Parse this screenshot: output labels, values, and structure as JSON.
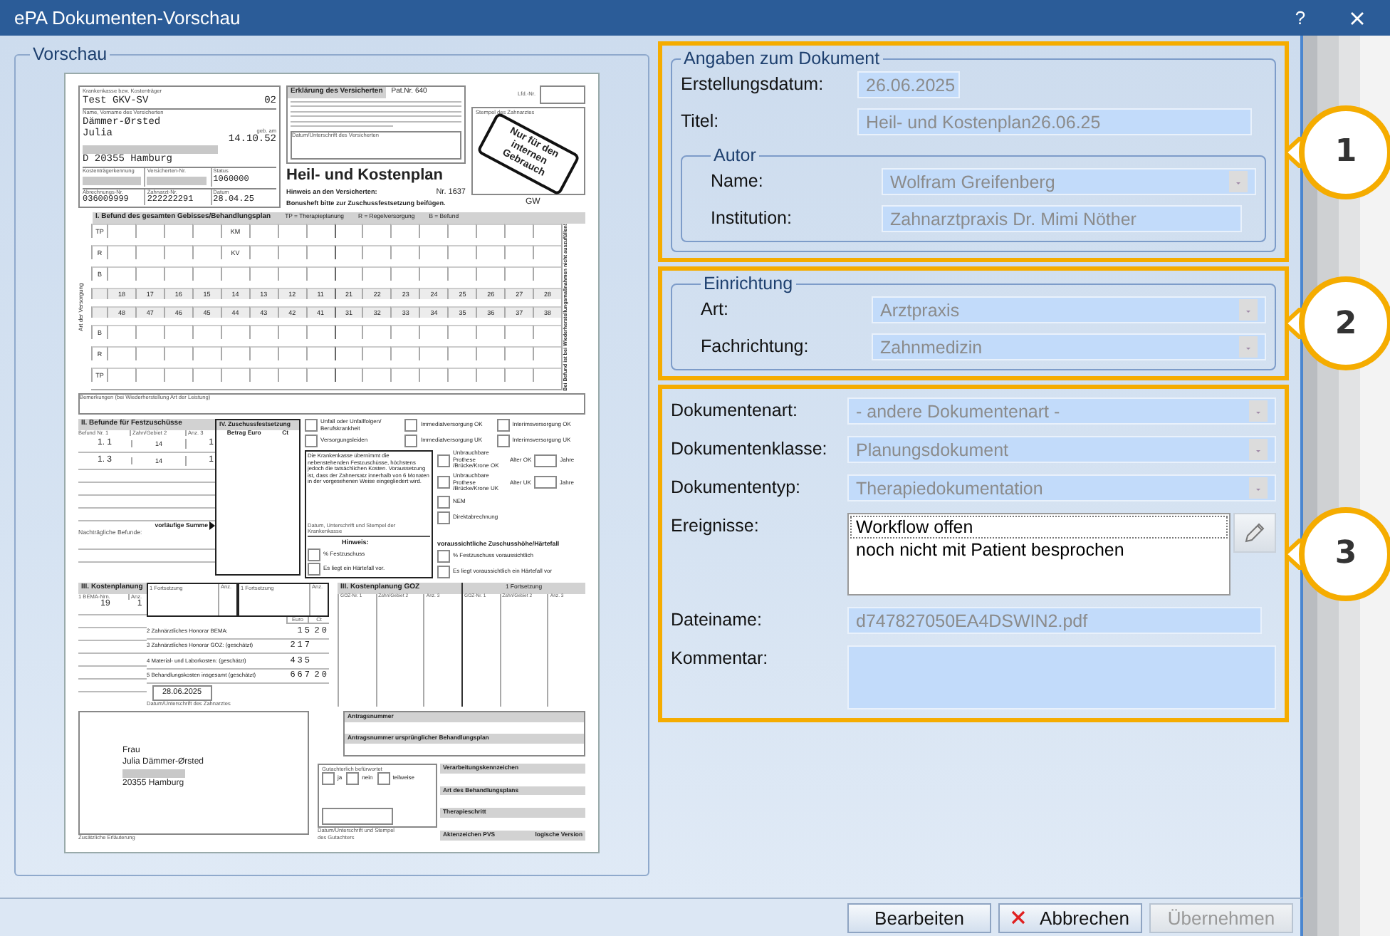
{
  "window": {
    "title": "ePA Dokumenten-Vorschau",
    "help": "?"
  },
  "preview": {
    "title": "Vorschau",
    "document": {
      "insured": {
        "insurer_label": "Krankenkasse bzw. Kostenträger",
        "insurer": "Test GKV-SV",
        "insurer_code": "02",
        "name_label": "Name, Vorname des Versicherten",
        "last_name": "Dämmer-Ørsted",
        "first_name": "Julia",
        "dob_label": "geb. am",
        "dob": "14.10.52",
        "city": "D 20355 Hamburg",
        "ids": [
          {
            "label": "Kostenträgerkennung"
          },
          {
            "label": "Versicherten-Nr."
          },
          {
            "label": "Status",
            "value": "1060000"
          }
        ],
        "numbers": [
          {
            "label": "Abrechnungs-Nr.",
            "value": "036009999"
          },
          {
            "label": "Zahnarzt-Nr.",
            "value": "222222291"
          },
          {
            "label": "Datum",
            "value": "28.04.25"
          }
        ]
      },
      "declaration": {
        "title": "Erklärung des Versicherten",
        "patient_no": "Pat.Nr. 640",
        "signature_label": "Datum/Unterschrift des Versicherten"
      },
      "plan": {
        "title": "Heil- und Kostenplan",
        "number": "Nr. 1637",
        "hint": "Hinweis an den Versicherten:",
        "hint_text": "Bonusheft bitte zur Zuschussfestsetzung beifügen."
      },
      "stamp": {
        "lfd_label": "Lfd.-Nr.",
        "label": "Stempel des Zahnarztes",
        "text": "Nur für den internen Gebrauch",
        "gw": "GW"
      },
      "findings": {
        "title": "I. Befund des gesamten Gebisses/Behandlungsplan",
        "legend": [
          "TP = Therapieplanung",
          "R = Regelversorgung",
          "B = Befund"
        ],
        "side_label": "Art der Versorgung",
        "upper_rows": [
          "TP",
          "R",
          "B"
        ],
        "upper_teeth": [
          "18",
          "17",
          "16",
          "15",
          "14",
          "13",
          "12",
          "11",
          "21",
          "22",
          "23",
          "24",
          "25",
          "26",
          "27",
          "28"
        ],
        "lower_teeth": [
          "48",
          "47",
          "46",
          "45",
          "44",
          "43",
          "42",
          "41",
          "31",
          "32",
          "33",
          "34",
          "35",
          "36",
          "37",
          "38"
        ],
        "lower_rows": [
          "B",
          "R",
          "TP"
        ],
        "marks": [
          "KM",
          "KV"
        ],
        "remarks_label": "Bemerkungen (bei Wiederherstellung Art der Leistung)",
        "side_note": "Bei Befund ist bei Wiederherstellungsmaßnahmen nicht auszufüllen!"
      },
      "subsidy": {
        "title": "II. Befunde für Festzuschüsse",
        "columns": [
          "Befund Nr. 1",
          "Zahn/Gebiet 2",
          "Anz. 3"
        ],
        "rows": [
          [
            "1. 1",
            "14",
            "1"
          ],
          [
            "1. 3",
            "14",
            "1"
          ]
        ],
        "sum_label": "vorläufige Summe",
        "later_label": "Nachträgliche Befunde:",
        "grant_title": "IV. Zuschussfestsetzung",
        "grant_columns": [
          "Betrag Euro",
          "Ct"
        ],
        "options": [
          {
            "label": "Unfall oder Unfallfolgen/ Berufskrankheit",
            "checked": false
          },
          {
            "label": "Immediatversorgung OK",
            "checked": false
          },
          {
            "label": "Interimsversorgung OK",
            "checked": false
          },
          {
            "label": "Versorgungsleiden",
            "checked": false
          },
          {
            "label": "Immediatversorgung UK",
            "checked": false
          },
          {
            "label": "Interimsversorgung UK",
            "checked": false
          }
        ],
        "note": "Die Krankenkasse übernimmt die nebenstehenden Festzuschüsse, höchstens jedoch die tatsächlichen Kosten. Voraussetzung ist, dass der Zahnersatz innerhalb von 6 Monaten in der vorgesehenen Weise eingegliedert wird.",
        "note_sign": "Datum, Unterschrift und Stempel der Krankenkasse",
        "prosthesis": [
          {
            "label": "Unbrauchbare Prothese /Brücke/Krone OK",
            "checked": false,
            "age": "Alter OK",
            "unit": "Jahre"
          },
          {
            "label": "Unbrauchbare Prothese /Brücke/Krone UK",
            "checked": false,
            "age": "Alter UK",
            "unit": "Jahre"
          }
        ],
        "extra_options": [
          {
            "label": "NEM",
            "checked": false
          },
          {
            "label": "Direktabrechnung",
            "checked": false
          }
        ],
        "hint_title": "Hinweis:",
        "hint_options": [
          {
            "label": "% Festzuschuss",
            "checked": false
          },
          {
            "label": "Es liegt ein Härtefall vor.",
            "checked": false
          }
        ],
        "forecast_title": "voraussichtliche Zuschusshöhe/Härtefall",
        "forecast_options": [
          {
            "label": "% Festzuschuss voraussichtlich",
            "checked": false
          },
          {
            "label": "Es liegt voraussichtlich ein Härtefall vor",
            "checked": false
          }
        ]
      },
      "costs": {
        "title": "III. Kostenplanung",
        "continuations": [
          {
            "label": "1 Fortsetzung",
            "count": "Anz."
          },
          {
            "label": "1 Fortsetzung",
            "count": "Anz."
          }
        ],
        "columns": [
          "1 BEMA-Nrn.",
          "Anz."
        ],
        "rows": [
          [
            "19",
            "1"
          ]
        ],
        "amount_columns": [
          "Euro",
          "Ct"
        ],
        "amounts": [
          {
            "label": "2 Zahnärztliches Honorar BEMA:",
            "euro": "15",
            "ct": "20"
          },
          {
            "label": "3 Zahnärztliches Honorar GOZ: (geschätzt)",
            "euro": "217"
          },
          {
            "label": "4 Material- und Laborkosten: (geschätzt)",
            "euro": "435"
          },
          {
            "label": "5 Behandlungskosten insgesamt (geschätzt)",
            "euro": "667",
            "ct": "20"
          }
        ],
        "date": "28.06.2025",
        "date_label": "Datum/Unterschrift des Zahnarztes",
        "goz_title": "III. Kostenplanung GOZ",
        "goz_continuation": "1 Fortsetzung",
        "goz_columns": [
          "GOZ-Nr. 1",
          "Zahn/Gebiet 2",
          "Anz. 3",
          "GOZ-Nr. 1",
          "Zahn/Gebiet 2",
          "Anz. 3"
        ]
      },
      "address": {
        "lines": [
          "Frau",
          "Julia Dämmer-Ørsted",
          "20355 Hamburg"
        ],
        "caption": "Zusätzliche Erläuterung"
      },
      "admin": {
        "application": [
          "Antragsnummer",
          "Antragsnummer ursprünglicher Behandlungsplan"
        ],
        "review_label": "Gutachterlich befürwortet",
        "review_options": [
          {
            "label": "ja",
            "checked": false
          },
          {
            "label": "nein",
            "checked": false
          },
          {
            "label": "teilweise",
            "checked": false
          }
        ],
        "review_sign": "Datum/Unterschrift und Stempel des Gutachters",
        "codes": [
          "Verarbeitungskennzeichen",
          "Art des Behandlungsplans",
          "Therapieschritt"
        ],
        "file_ref": "Aktenzeichen PVS",
        "version": "logische Version"
      }
    }
  },
  "details": {
    "sections": [
      {
        "callout": "1",
        "title": "Angaben zum Dokument",
        "fields": [
          {
            "label": "Erstellungsdatum:",
            "kind": "date",
            "value": "26.06.2025"
          },
          {
            "label": "Titel:",
            "kind": "text",
            "value": "Heil- und Kostenplan26.06.25"
          }
        ],
        "groups": [
          {
            "title": "Autor",
            "fields": [
              {
                "label": "Name:",
                "kind": "combo",
                "value": "Wolfram Greifenberg"
              },
              {
                "label": "Institution:",
                "kind": "text",
                "value": "Zahnarztpraxis Dr. Mimi Nöther"
              }
            ]
          }
        ]
      },
      {
        "callout": "2",
        "groups": [
          {
            "title": "Einrichtung",
            "fields": [
              {
                "label": "Art:",
                "kind": "combo",
                "value": "Arztpraxis"
              },
              {
                "label": "Fachrichtung:",
                "kind": "combo",
                "value": "Zahnmedizin"
              }
            ]
          }
        ]
      },
      {
        "callout": "3",
        "fields": [
          {
            "label": "Dokumentenart:",
            "kind": "combo",
            "value": "- andere Dokumentenart -"
          },
          {
            "label": "Dokumentenklasse:",
            "kind": "combo",
            "value": "Planungsdokument"
          },
          {
            "label": "Dokumententyp:",
            "kind": "combo",
            "value": "Therapiedokumentation"
          },
          {
            "label": "Ereignisse:",
            "kind": "list",
            "items": [
              {
                "text": "Workflow offen",
                "selected": true
              },
              {
                "text": "noch nicht mit Patient besprochen",
                "selected": false
              }
            ]
          },
          {
            "label": "Dateiname:",
            "kind": "text",
            "value": "d747827050EA4DSWIN2.pdf"
          },
          {
            "label": "Kommentar:",
            "kind": "memo"
          }
        ]
      }
    ]
  },
  "buttons": [
    {
      "label": "Bearbeiten",
      "disabled": false,
      "kind": "plain"
    },
    {
      "label": "Abbrechen",
      "disabled": false,
      "kind": "cancel"
    },
    {
      "label": "Übernehmen",
      "disabled": true,
      "kind": "plain"
    }
  ]
}
